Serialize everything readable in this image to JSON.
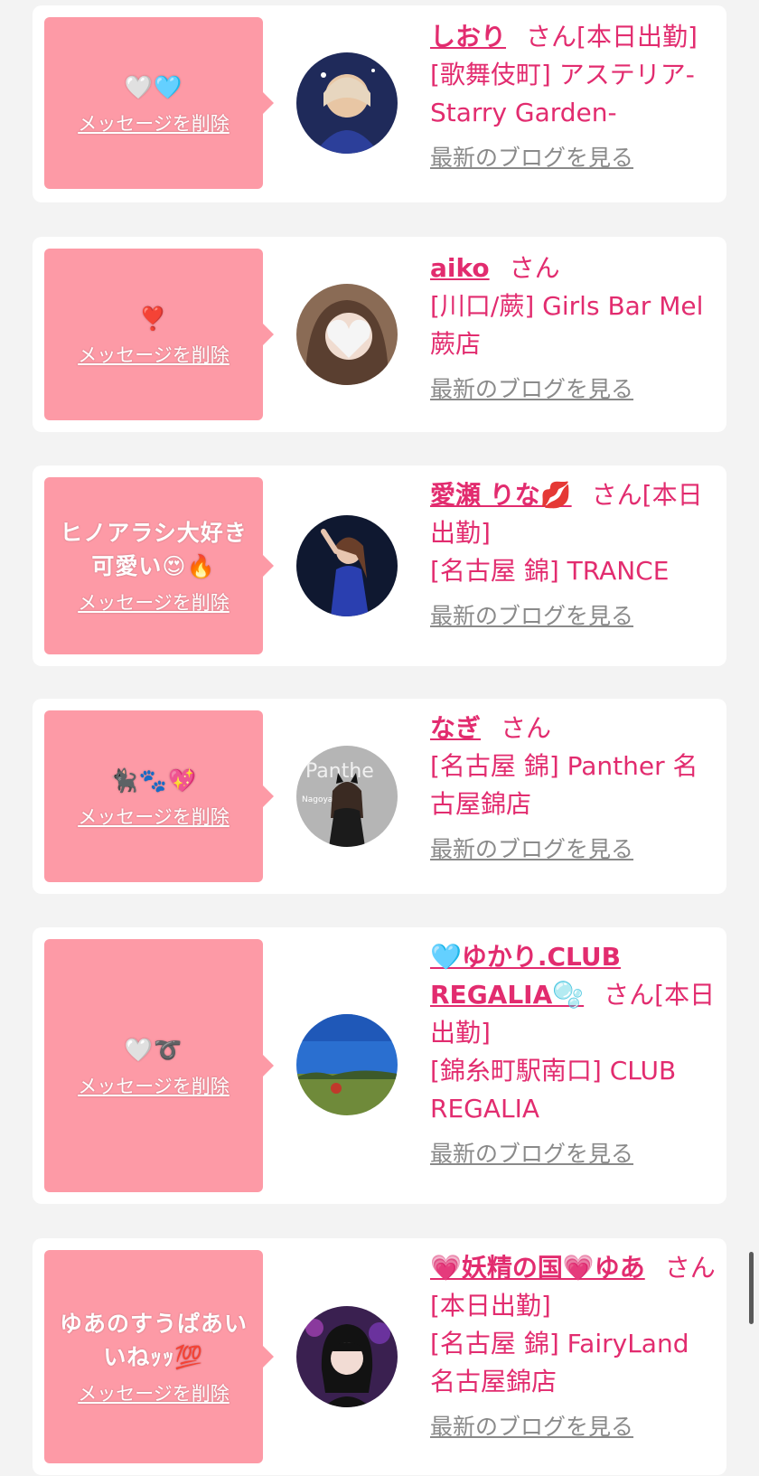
{
  "colors": {
    "accent": "#e22c6f",
    "bubble": "#fd9aa6",
    "link_gray": "#8a8a8a",
    "background": "#f3f3f3"
  },
  "cards": [
    {
      "message": "🤍🩵",
      "delete_label": "メッセージを削除",
      "name": "しおり",
      "honorific": "さん",
      "status": "[本日出勤]",
      "shop": "[歌舞伎町] アステリア-Starry Garden-",
      "blog_link": "最新のブログを見る",
      "avatar_icon": "profile-photo-icon"
    },
    {
      "message": "❣️",
      "delete_label": "メッセージを削除",
      "name": "aiko",
      "honorific": "さん",
      "status": "",
      "shop": "[川口/蕨] Girls Bar Mel 蕨店",
      "blog_link": "最新のブログを見る",
      "avatar_icon": "profile-photo-icon"
    },
    {
      "message": "ヒノアラシ大好き可愛い😍🔥",
      "delete_label": "メッセージを削除",
      "name": "愛瀬 りな💋",
      "honorific": "さん",
      "status": "[本日出勤]",
      "shop": "[名古屋 錦] TRANCE",
      "blog_link": "最新のブログを見る",
      "avatar_icon": "profile-photo-icon"
    },
    {
      "message": "🐈‍⬛🐾💖",
      "delete_label": "メッセージを削除",
      "name": "なぎ",
      "honorific": "さん",
      "status": "",
      "shop": "[名古屋 錦] Panther 名古屋錦店",
      "blog_link": "最新のブログを見る",
      "avatar_icon": "profile-photo-icon"
    },
    {
      "message": "🤍➰",
      "delete_label": "メッセージを削除",
      "name": "🩵ゆかり.CLUB REGALIA🫧",
      "honorific": "さん",
      "status": "[本日出勤]",
      "shop": "[錦糸町駅南口] CLUB REGALIA",
      "blog_link": "最新のブログを見る",
      "avatar_icon": "profile-photo-icon"
    },
    {
      "message": "ゆあのすうぱあいいねｯｯ💯",
      "delete_label": "メッセージを削除",
      "name": "💗妖精の国💗ゆあ",
      "honorific": "さん",
      "status": "[本日出勤]",
      "shop": "[名古屋 錦] FairyLand 名古屋錦店",
      "blog_link": "最新のブログを見る",
      "avatar_icon": "profile-photo-icon"
    }
  ]
}
